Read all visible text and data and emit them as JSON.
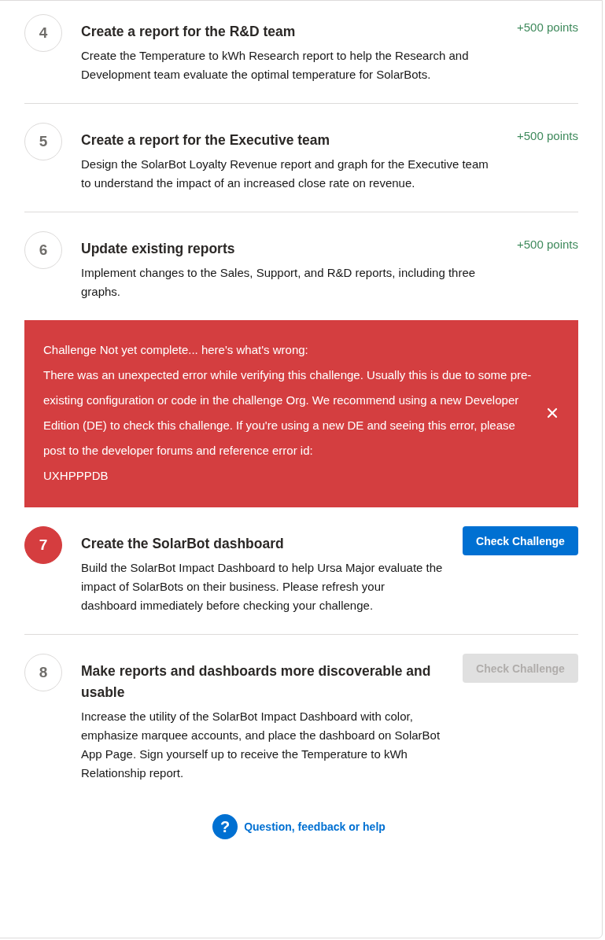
{
  "steps": [
    {
      "number": "4",
      "title": "Create a report for the R&D team",
      "description": "Create the Temperature to kWh Research report to help the Research and Development team evaluate the optimal temperature for SolarBots.",
      "active": false,
      "kind": "points",
      "points": "+500 points"
    },
    {
      "number": "5",
      "title": "Create a report for the Executive team",
      "description": "Design the SolarBot Loyalty Revenue report and graph for the Executive team to understand the impact of an increased close rate on revenue.",
      "active": false,
      "kind": "points",
      "points": "+500 points"
    },
    {
      "number": "6",
      "title": "Update existing reports",
      "description": "Implement changes to the Sales, Support, and R&D reports, including three graphs.",
      "active": false,
      "kind": "points",
      "points": "+500 points",
      "error": {
        "heading": "Challenge Not yet complete... here's what's wrong:",
        "message": "There was an unexpected error while verifying this challenge. Usually this is due to some pre-existing configuration or code in the challenge Org. We recommend using a new Developer Edition (DE) to check this challenge. If you're using a new DE and seeing this error, please post to the developer forums and reference error id:",
        "code": "UXHPPPDB"
      }
    },
    {
      "number": "7",
      "title": "Create the SolarBot dashboard",
      "description": "Build the SolarBot Impact Dashboard to help Ursa Major evaluate the impact of SolarBots on their business. Please refresh your dashboard immediately before checking your challenge.",
      "active": true,
      "kind": "button",
      "button": {
        "label": "Check Challenge",
        "disabled": false
      }
    },
    {
      "number": "8",
      "title": "Make reports and dashboards more discoverable and usable",
      "description": "Increase the utility of the SolarBot Impact Dashboard with color, emphasize marquee accounts, and place the dashboard on SolarBot App Page. Sign yourself up to receive the Temperature to kWh Relationship report.",
      "active": false,
      "kind": "button",
      "button": {
        "label": "Check Challenge",
        "disabled": true
      }
    }
  ],
  "help": {
    "icon": "?",
    "label": "Question, feedback or help"
  }
}
